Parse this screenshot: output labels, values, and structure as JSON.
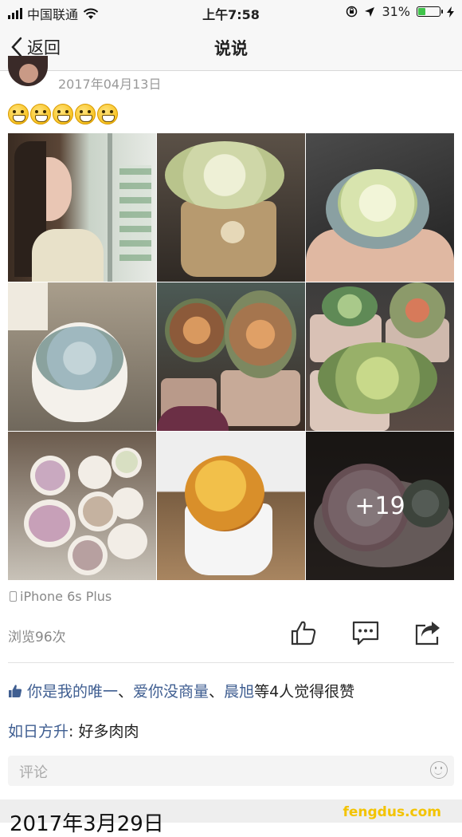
{
  "status_bar": {
    "carrier": "中国联通",
    "time": "上午7:58",
    "battery_percent": "31%",
    "battery_level": 0.31,
    "icons": [
      "signal-icon",
      "wifi-icon",
      "rotation-lock-icon",
      "location-icon",
      "battery-icon",
      "charging-icon"
    ]
  },
  "nav": {
    "back_label": "返回",
    "title": "说说"
  },
  "post": {
    "date": "2017年04月13日",
    "emoji_count": 5,
    "photos": [
      {
        "name": "selfie-photo"
      },
      {
        "name": "succulent-in-ornate-pot-photo"
      },
      {
        "name": "succulent-in-hand-photo"
      },
      {
        "name": "succulent-white-pot-photo"
      },
      {
        "name": "jade-plants-photo"
      },
      {
        "name": "succulent-pots-group-photo"
      },
      {
        "name": "small-pots-collection-photo"
      },
      {
        "name": "cactus-photo"
      },
      {
        "name": "succulent-dish-photo"
      }
    ],
    "more_photos": "+19",
    "device": "iPhone 6s Plus",
    "views": "浏览96次"
  },
  "likes": {
    "names": [
      "你是我的唯一",
      "爱你没商量",
      "晨旭"
    ],
    "separator": "、",
    "suffix": "等4人觉得很赞"
  },
  "comment": {
    "author": "如日方升",
    "text": ": 好多肉肉"
  },
  "comment_input": {
    "placeholder": "评论"
  },
  "next_post": {
    "date": "2017年3月29日"
  },
  "watermark": "fengdus.com",
  "colors": {
    "link": "#3f5e91",
    "battery_green": "#3fc44a",
    "watermark": "#f3c300"
  }
}
